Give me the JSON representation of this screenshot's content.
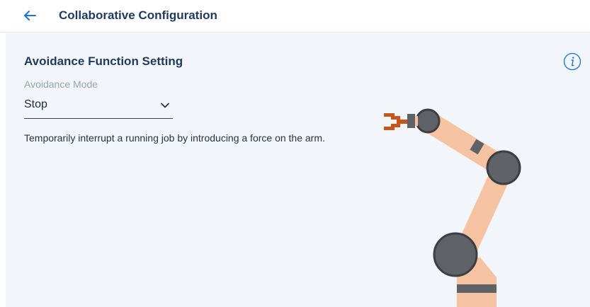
{
  "header": {
    "title": "Collaborative Configuration",
    "back_icon": "arrow-left-icon"
  },
  "section": {
    "title": "Avoidance Function Setting",
    "info_icon": "info-icon"
  },
  "avoidance_mode": {
    "label": "Avoidance Mode",
    "value": "Stop",
    "chevron_icon": "chevron-down-icon"
  },
  "description": "Temporarily interrupt a running job by introducing a force on the arm.",
  "colors": {
    "accent": "#1e6fd9",
    "title": "#1e3a5f",
    "panel_bg": "#f2f6fa",
    "robot_link": "#f6c3a2",
    "robot_joint": "#5f6266",
    "robot_gripper": "#c8561c"
  }
}
